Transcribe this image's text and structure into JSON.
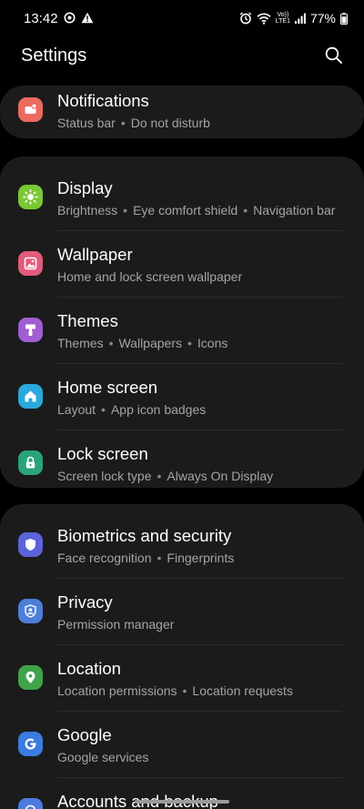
{
  "status_bar": {
    "time": "13:42",
    "battery": "77%",
    "volte_line1": "Vo))",
    "volte_line2": "LTE1"
  },
  "header": {
    "title": "Settings"
  },
  "groups": [
    {
      "items": [
        {
          "title": "Notifications",
          "subtitle": [
            "Status bar",
            "Do not disturb"
          ],
          "icon": "notifications-icon",
          "color": "#ec6a5f"
        }
      ]
    },
    {
      "items": [
        {
          "title": "Display",
          "subtitle": [
            "Brightness",
            "Eye comfort shield",
            "Navigation bar"
          ],
          "icon": "display-icon",
          "color": "#7cc734"
        },
        {
          "title": "Wallpaper",
          "subtitle": [
            "Home and lock screen wallpaper"
          ],
          "icon": "wallpaper-icon",
          "color": "#e25b7c"
        },
        {
          "title": "Themes",
          "subtitle": [
            "Themes",
            "Wallpapers",
            "Icons"
          ],
          "icon": "themes-icon",
          "color": "#a05ed3"
        },
        {
          "title": "Home screen",
          "subtitle": [
            "Layout",
            "App icon badges"
          ],
          "icon": "home-screen-icon",
          "color": "#29a9dc"
        },
        {
          "title": "Lock screen",
          "subtitle": [
            "Screen lock type",
            "Always On Display"
          ],
          "icon": "lock-screen-icon",
          "color": "#2aa37a"
        }
      ]
    },
    {
      "items": [
        {
          "title": "Biometrics and security",
          "subtitle": [
            "Face recognition",
            "Fingerprints"
          ],
          "icon": "biometrics-icon",
          "color": "#5b63d9"
        },
        {
          "title": "Privacy",
          "subtitle": [
            "Permission manager"
          ],
          "icon": "privacy-icon",
          "color": "#4d7fd8"
        },
        {
          "title": "Location",
          "subtitle": [
            "Location permissions",
            "Location requests"
          ],
          "icon": "location-icon",
          "color": "#3fa34a"
        },
        {
          "title": "Google",
          "subtitle": [
            "Google services"
          ],
          "icon": "google-icon",
          "color": "#3c7be0"
        },
        {
          "title": "Accounts and backup",
          "subtitle": [],
          "icon": "accounts-icon",
          "color": "#4c7be0"
        }
      ]
    }
  ]
}
